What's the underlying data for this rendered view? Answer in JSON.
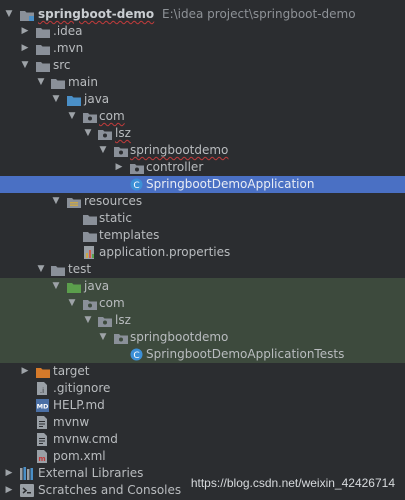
{
  "tree": {
    "root_name": "springboot-demo",
    "root_path": "E:\\idea project\\springboot-demo",
    "items": [
      {
        "label": ".idea",
        "icon": "folder-icon"
      },
      {
        "label": ".mvn",
        "icon": "folder-icon"
      },
      {
        "label": "src",
        "icon": "folder-icon"
      },
      {
        "label": "main",
        "icon": "folder-icon"
      },
      {
        "label": "java",
        "icon": "source-folder-icon"
      },
      {
        "label": "com",
        "icon": "package-icon"
      },
      {
        "label": "lsz",
        "icon": "package-icon"
      },
      {
        "label": "springbootdemo",
        "icon": "package-icon"
      },
      {
        "label": "controller",
        "icon": "package-icon"
      },
      {
        "label": "SpringbootDemoApplication",
        "icon": "class-icon"
      },
      {
        "label": "resources",
        "icon": "resources-folder-icon"
      },
      {
        "label": "static",
        "icon": "folder-icon"
      },
      {
        "label": "templates",
        "icon": "folder-icon"
      },
      {
        "label": "application.properties",
        "icon": "properties-file-icon"
      },
      {
        "label": "test",
        "icon": "folder-icon"
      },
      {
        "label": "java",
        "icon": "test-source-folder-icon"
      },
      {
        "label": "com",
        "icon": "package-icon"
      },
      {
        "label": "lsz",
        "icon": "package-icon"
      },
      {
        "label": "springbootdemo",
        "icon": "package-icon"
      },
      {
        "label": "SpringbootDemoApplicationTests",
        "icon": "class-icon"
      },
      {
        "label": "target",
        "icon": "excluded-folder-icon"
      },
      {
        "label": ".gitignore",
        "icon": "gitignore-file-icon"
      },
      {
        "label": "HELP.md",
        "icon": "markdown-file-icon"
      },
      {
        "label": "mvnw",
        "icon": "file-icon"
      },
      {
        "label": "mvnw.cmd",
        "icon": "file-icon"
      },
      {
        "label": "pom.xml",
        "icon": "maven-file-icon"
      },
      {
        "label": "External Libraries",
        "icon": "libraries-icon"
      },
      {
        "label": "Scratches and Consoles",
        "icon": "scratches-icon"
      }
    ]
  },
  "watermark": "https://blog.csdn.net/weixin_42426714",
  "colors": {
    "background": "#2b2d30",
    "selection": "#4a70c4",
    "test_highlight": "#3d4a3d",
    "folder": "#8a9099",
    "source_folder": "#4a8fc7",
    "test_folder": "#5b9e4c",
    "excluded_folder": "#d67a2a",
    "class": "#3c8fd6",
    "error_underline": "#c23b3b"
  }
}
